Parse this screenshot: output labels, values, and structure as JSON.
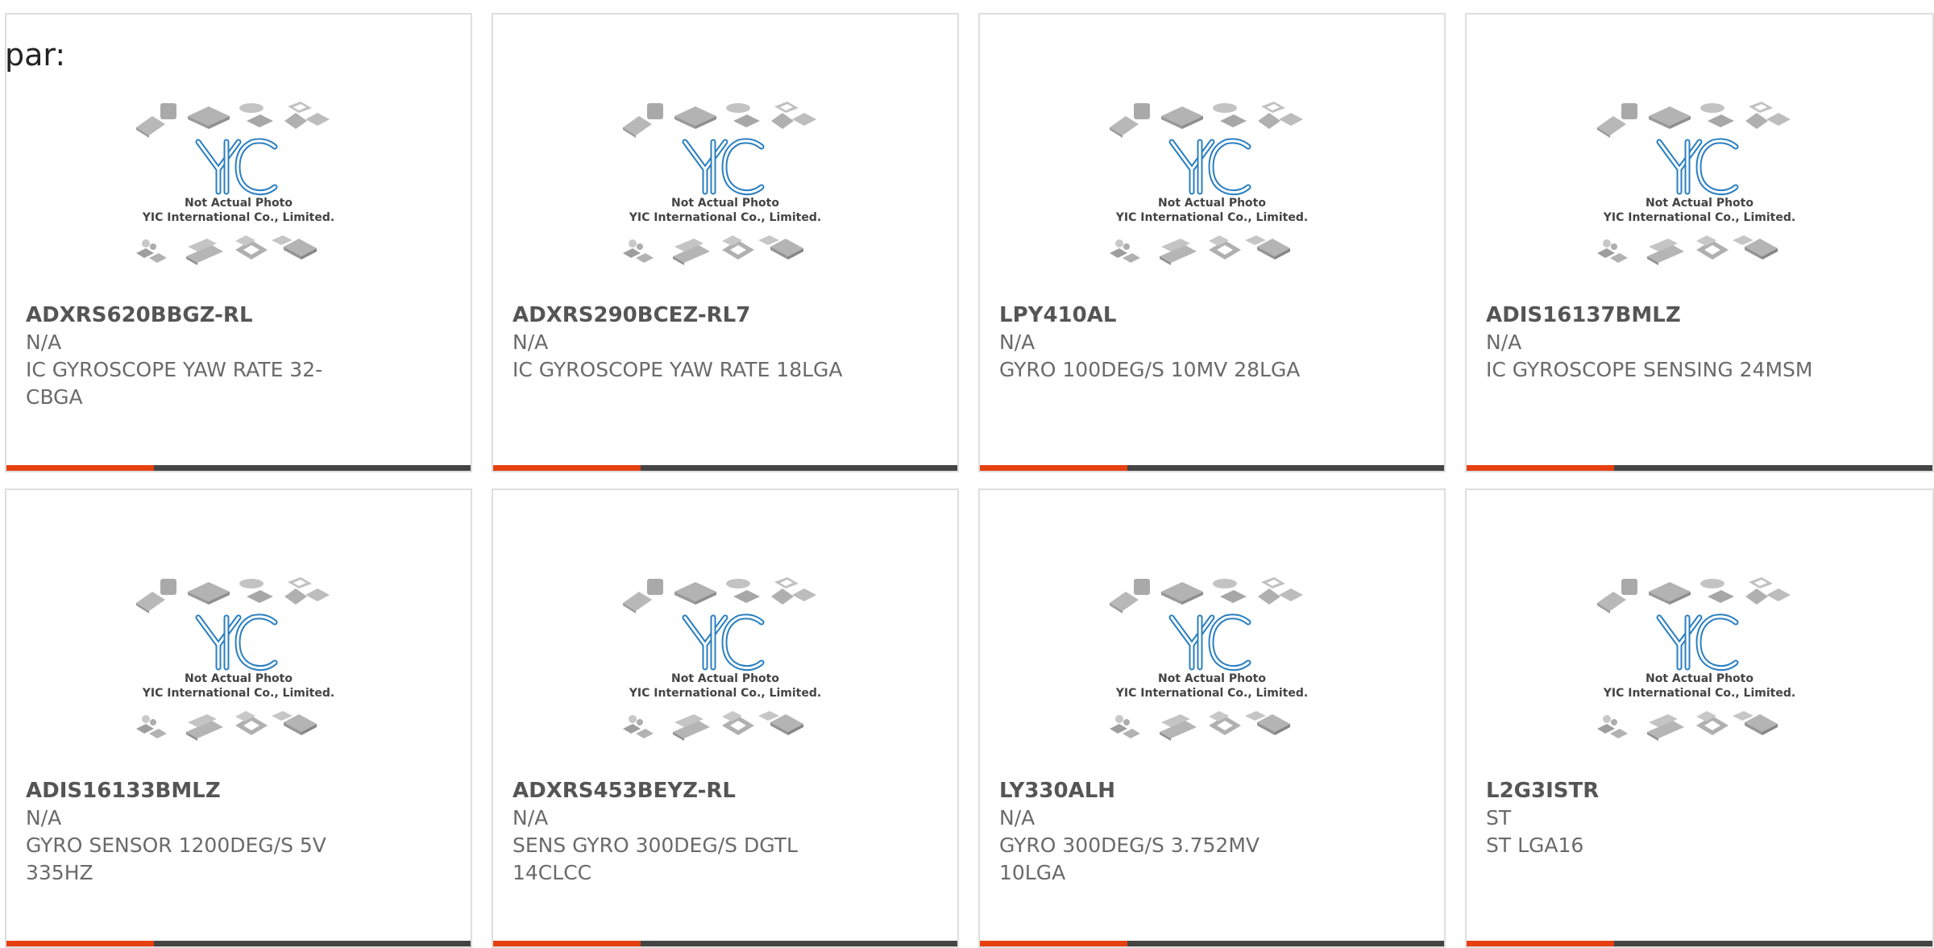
{
  "page_prefix": "par:",
  "image_caption": {
    "line1": "Not Actual Photo",
    "line2": "YIC International Co., Limited.",
    "logo_text": "YIC"
  },
  "colors": {
    "accent": "#e64010",
    "bar": "#444444",
    "logo_blue": "#2a7fc0",
    "chip_gray": "#b5b5b5"
  },
  "products": [
    {
      "part": "ADXRS620BBGZ-RL",
      "manufacturer": "N/A",
      "description": "IC GYROSCOPE YAW RATE 32-CBGA"
    },
    {
      "part": "ADXRS290BCEZ-RL7",
      "manufacturer": "N/A",
      "description": "IC GYROSCOPE YAW RATE 18LGA"
    },
    {
      "part": "LPY410AL",
      "manufacturer": "N/A",
      "description": "GYRO 100DEG/S 10MV 28LGA"
    },
    {
      "part": "ADIS16137BMLZ",
      "manufacturer": "N/A",
      "description": "IC GYROSCOPE SENSING 24MSM"
    },
    {
      "part": "ADIS16133BMLZ",
      "manufacturer": "N/A",
      "description": "GYRO SENSOR 1200DEG/S 5V 335HZ"
    },
    {
      "part": "ADXRS453BEYZ-RL",
      "manufacturer": "N/A",
      "description": "SENS GYRO 300DEG/S DGTL 14CLCC"
    },
    {
      "part": "LY330ALH",
      "manufacturer": "N/A",
      "description": "GYRO 300DEG/S 3.752MV 10LGA"
    },
    {
      "part": "L2G3ISTR",
      "manufacturer": "ST",
      "description": "ST LGA16"
    }
  ]
}
